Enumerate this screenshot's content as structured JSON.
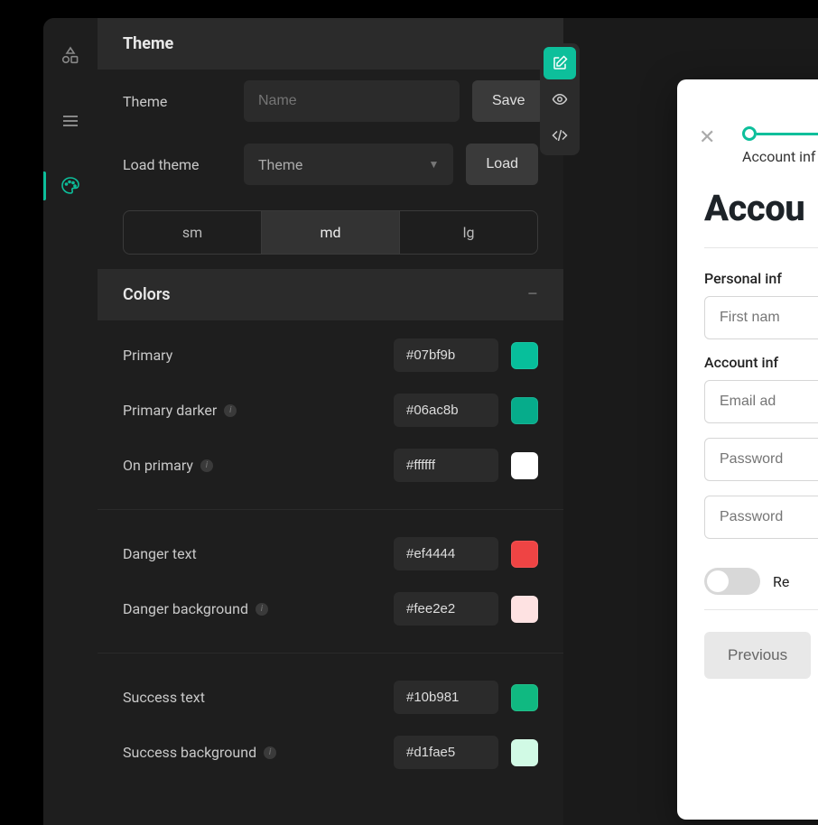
{
  "panel": {
    "title": "Theme",
    "theme_label": "Theme",
    "theme_placeholder": "Name",
    "save_label": "Save",
    "load_label": "Load theme",
    "load_placeholder": "Theme",
    "load_btn": "Load",
    "sizes": {
      "sm": "sm",
      "md": "md",
      "lg": "lg",
      "active": "md"
    }
  },
  "colors_section": {
    "title": "Colors",
    "groups": [
      [
        {
          "label": "Primary",
          "hex": "#07bf9b",
          "info": false
        },
        {
          "label": "Primary darker",
          "hex": "#06ac8b",
          "info": true
        },
        {
          "label": "On primary",
          "hex": "#ffffff",
          "info": true
        }
      ],
      [
        {
          "label": "Danger text",
          "hex": "#ef4444",
          "info": false
        },
        {
          "label": "Danger background",
          "hex": "#fee2e2",
          "info": true
        }
      ],
      [
        {
          "label": "Success text",
          "hex": "#10b981",
          "info": false
        },
        {
          "label": "Success background",
          "hex": "#d1fae5",
          "info": true
        }
      ]
    ]
  },
  "preview": {
    "step_label": "Account inf",
    "heading": "Accou",
    "personal_label": "Personal inf",
    "first_name_ph": "First nam",
    "account_label": "Account inf",
    "email_ph": "Email ad",
    "password_ph": "Password",
    "password2_ph": "Password",
    "remember_label": "Re",
    "prev_btn": "Previous"
  }
}
